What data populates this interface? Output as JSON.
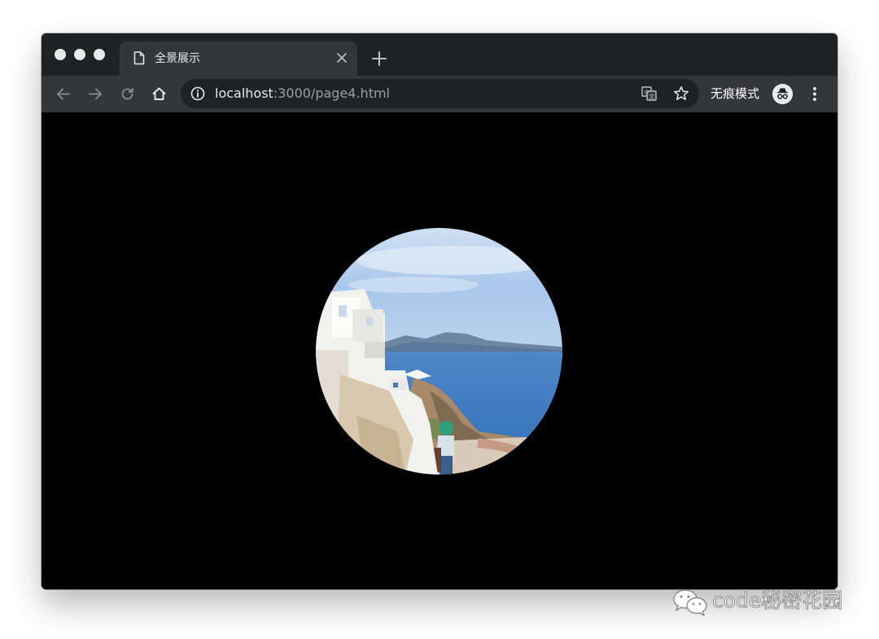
{
  "browser": {
    "window_controls": [
      "close-dot",
      "minimize-dot",
      "maximize-dot"
    ],
    "tab": {
      "title": "全景展示",
      "icon": "page-icon",
      "close_icon": "close-icon"
    },
    "new_tab_icon": "plus-icon",
    "toolbar": {
      "back_icon": "arrow-left-icon",
      "forward_icon": "arrow-right-icon",
      "reload_icon": "reload-icon",
      "home_icon": "home-icon",
      "url_host": "localhost",
      "url_rest": ":3000/page4.html",
      "info_icon": "info-icon",
      "translate_icon": "translate-icon",
      "bookmark_icon": "star-icon",
      "incognito_label": "无痕模式",
      "incognito_icon": "incognito-icon",
      "menu_icon": "kebab-menu-icon"
    },
    "colors": {
      "tabstrip": "#202124",
      "toolbar": "#35363a",
      "omnibox": "#202124",
      "content_background": "#000000"
    }
  },
  "content": {
    "panorama_view": "circular-panorama-image"
  },
  "watermark": {
    "icon": "wechat-icon",
    "text": "code秘密花园"
  }
}
